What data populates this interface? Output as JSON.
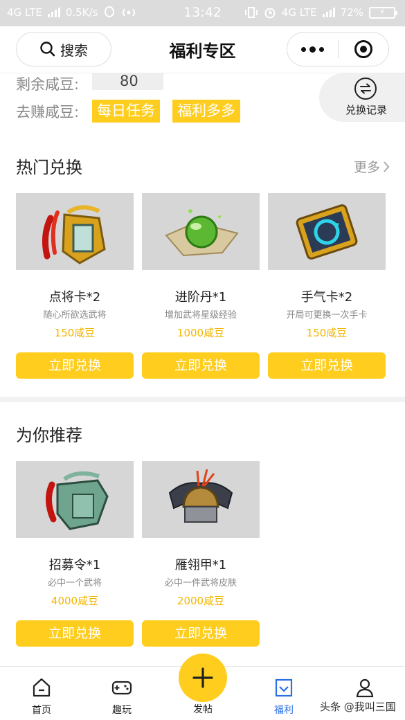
{
  "status_bar": {
    "network_left": "4G LTE",
    "speed": "0.5K/s",
    "time": "13:42",
    "network_right": "4G LTE",
    "battery": "72%"
  },
  "header": {
    "search_label": "搜索",
    "title": "福利专区"
  },
  "beans": {
    "remaining_label": "剩余咸豆:",
    "remaining_value": "80",
    "earn_label": "去赚咸豆:",
    "earn_tags": [
      "每日任务",
      "福利多多"
    ],
    "records_label": "兑换记录"
  },
  "hot_section": {
    "title": "热门兑换",
    "more_label": "更多",
    "items": [
      {
        "name": "点将卡*2",
        "desc": "随心所欲选武将",
        "price": "150咸豆",
        "button": "立即兑换",
        "icon": "general-card-icon"
      },
      {
        "name": "进阶丹*1",
        "desc": "增加武将星级经验",
        "price": "1000咸豆",
        "button": "立即兑换",
        "icon": "advance-pill-icon"
      },
      {
        "name": "手气卡*2",
        "desc": "开局可更换一次手卡",
        "price": "150咸豆",
        "button": "立即兑换",
        "icon": "luck-card-icon"
      }
    ]
  },
  "recommend_section": {
    "title": "为你推荐",
    "items": [
      {
        "name": "招募令*1",
        "desc": "必中一个武将",
        "price": "4000咸豆",
        "button": "立即兑换",
        "icon": "recruit-token-icon"
      },
      {
        "name": "雁翎甲*1",
        "desc": "必中一件武将皮肤",
        "price": "2000咸豆",
        "button": "立即兑换",
        "icon": "armor-icon"
      }
    ]
  },
  "bottom_nav": {
    "items": [
      {
        "label": "首页",
        "icon": "home-icon"
      },
      {
        "label": "趣玩",
        "icon": "gamepad-icon"
      },
      {
        "label": "发帖",
        "icon": "plus-icon"
      },
      {
        "label": "福利",
        "icon": "welfare-icon",
        "active": true
      },
      {
        "label": "我",
        "icon": "profile-icon"
      }
    ]
  },
  "watermark": "头条 @我叫三国",
  "colors": {
    "accent_yellow": "#ffcd1e",
    "price_yellow": "#f2b600",
    "active_blue": "#2a6fe6"
  }
}
